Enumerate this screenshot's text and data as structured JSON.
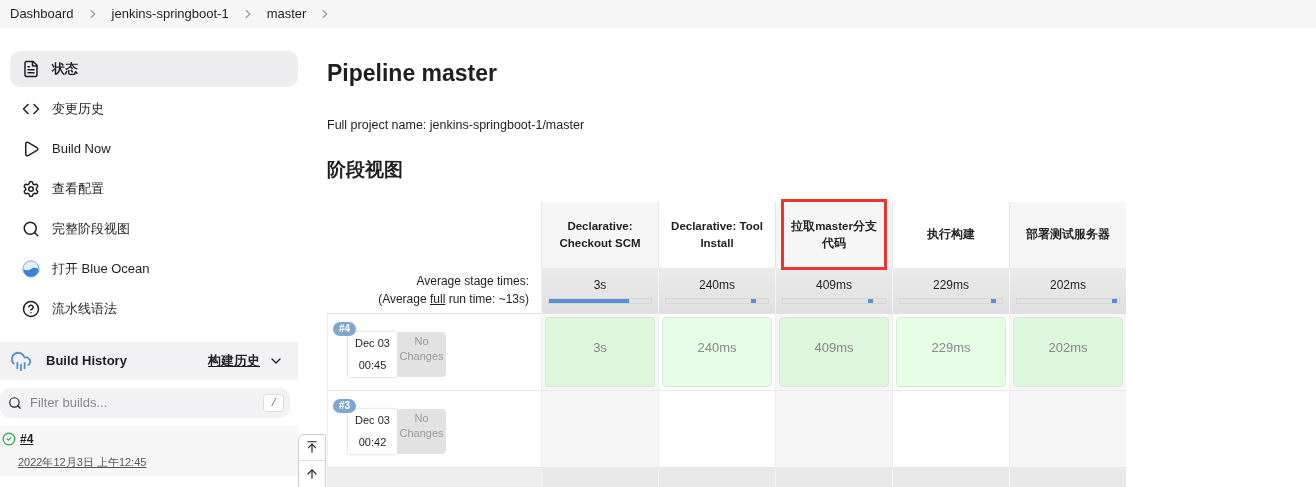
{
  "breadcrumbs": [
    "Dashboard",
    "jenkins-springboot-1",
    "master"
  ],
  "sidebar": {
    "items": [
      {
        "label": "状态",
        "selected": true
      },
      {
        "label": "变更历史",
        "selected": false
      },
      {
        "label": "Build Now",
        "selected": false
      },
      {
        "label": "查看配置",
        "selected": false
      },
      {
        "label": "完整阶段视图",
        "selected": false
      },
      {
        "label": "打开 Blue Ocean",
        "selected": false
      },
      {
        "label": "流水线语法",
        "selected": false
      }
    ]
  },
  "build_history": {
    "title": "Build History",
    "link": "构建历史",
    "filter_placeholder": "Filter builds...",
    "shortcut": "/",
    "builds": [
      {
        "number": "#4",
        "date": "2022年12月3日 上午12:45"
      }
    ]
  },
  "page": {
    "title": "Pipeline master",
    "full_name": "Full project name: jenkins-springboot-1/master",
    "stage_view_title": "阶段视图"
  },
  "stage_view": {
    "avg_label": "Average stage times:",
    "avg_run_prefix": "(Average ",
    "avg_run_link": "full",
    "avg_run_suffix": " run time: ~13s)",
    "stages": [
      {
        "name": "Declarative: Checkout SCM",
        "avg": "3s",
        "kind": "full",
        "level": 0.78,
        "highlighted": false
      },
      {
        "name": "Declarative: Tool Install",
        "avg": "240ms",
        "kind": "marker",
        "level": 0.88,
        "highlighted": false
      },
      {
        "name": "拉取master分支代码",
        "avg": "409ms",
        "kind": "marker",
        "level": 0.88,
        "highlighted": true
      },
      {
        "name": "执行构建",
        "avg": "229ms",
        "kind": "marker",
        "level": 0.94,
        "highlighted": false
      },
      {
        "name": "部署测试服务器",
        "avg": "202ms",
        "kind": "marker",
        "level": 0.98,
        "highlighted": false
      }
    ],
    "builds": [
      {
        "badge": "#4",
        "date": "Dec 03",
        "time": "00:45",
        "changes": "No Changes",
        "cells": [
          "3s",
          "240ms",
          "409ms",
          "229ms",
          "202ms"
        ]
      },
      {
        "badge": "#3",
        "date": "Dec 03",
        "time": "00:42",
        "changes": "No Changes"
      }
    ]
  }
}
